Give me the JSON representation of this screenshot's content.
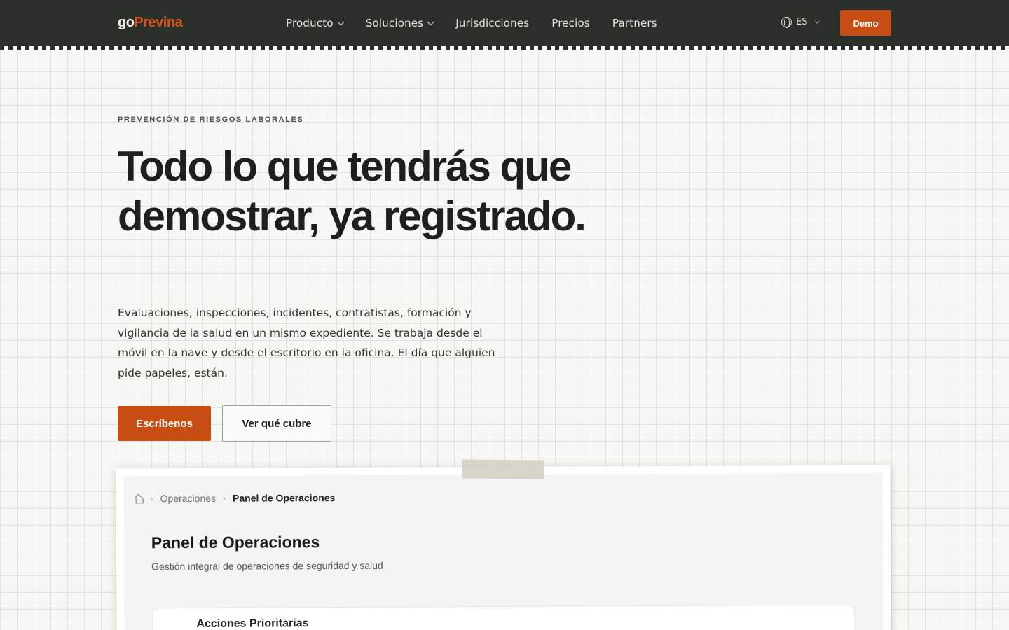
{
  "nav": {
    "logo_go": "go",
    "logo_brand": "Previna",
    "links": [
      {
        "label": "Producto"
      },
      {
        "label": "Soluciones"
      },
      {
        "label": "Jurisdicciones"
      },
      {
        "label": "Precios"
      },
      {
        "label": "Partners"
      }
    ],
    "language": "ES",
    "demo_label": "Demo"
  },
  "hero": {
    "eyebrow": "PREVENCIÓN DE RIESGOS LABORALES",
    "headline": "Todo lo que tendrás que demostrar, ya registrado.",
    "lede": "Evaluaciones, inspecciones, incidentes, contratistas, formación y vigilancia de la salud en un mismo expediente. Se trabaja desde el móvil en la nave y desde el escritorio en la oficina. El día que alguien pide papeles, están.",
    "primary_cta": "Escríbenos",
    "secondary_cta": "Ver qué cubre"
  },
  "preview": {
    "breadcrumb": [
      "Operaciones",
      "Panel de Operaciones"
    ],
    "title": "Panel de Operaciones",
    "subtitle": "Gestión integral de operaciones de seguridad y salud",
    "section_title": "Acciones Prioritarias"
  },
  "colors": {
    "nav_bg": "#2a2f29",
    "accent": "#c84d13",
    "page_bg": "#f7f7f3"
  }
}
